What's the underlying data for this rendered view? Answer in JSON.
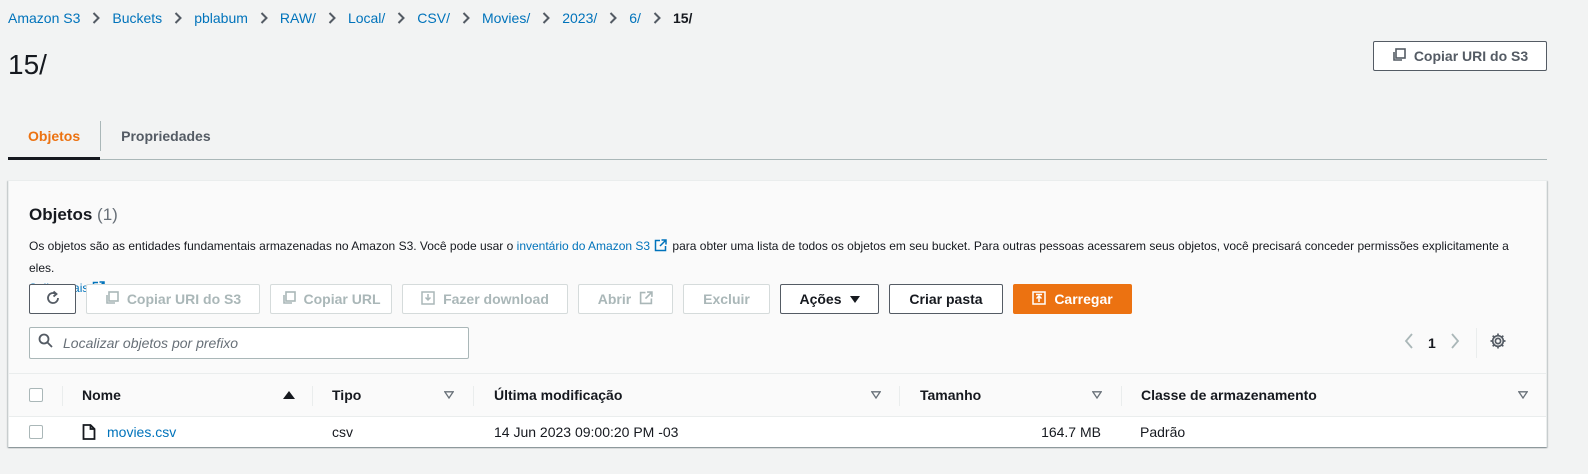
{
  "breadcrumbs": [
    "Amazon S3",
    "Buckets",
    "pblabum",
    "RAW/",
    "Local/",
    "CSV/",
    "Movies/",
    "2023/",
    "6/",
    "15/"
  ],
  "page_title": "15/",
  "header": {
    "copy_uri_label": "Copiar URI do S3"
  },
  "tabs": {
    "objects": "Objetos",
    "properties": "Propriedades"
  },
  "panel": {
    "title": "Objetos",
    "count": "(1)",
    "desc_before": "Os objetos são as entidades fundamentais armazenadas no Amazon S3. Você pode usar o ",
    "desc_link": "inventário do Amazon S3",
    "desc_after": " para obter uma lista de todos os objetos em seu bucket. Para outras pessoas acessarem seus objetos, você precisará conceder permissões explicitamente a eles.",
    "learn_more": "Saiba mais"
  },
  "toolbar": {
    "copy_uri": "Copiar URI do S3",
    "copy_url": "Copiar URL",
    "download": "Fazer download",
    "open": "Abrir",
    "delete": "Excluir",
    "actions": "Ações",
    "create_folder": "Criar pasta",
    "upload": "Carregar"
  },
  "search": {
    "placeholder": "Localizar objetos por prefixo"
  },
  "pagination": {
    "page": "1"
  },
  "table": {
    "headers": {
      "name": "Nome",
      "type": "Tipo",
      "modified": "Última modificação",
      "size": "Tamanho",
      "storage_class": "Classe de armazenamento"
    },
    "rows": [
      {
        "name": "movies.csv",
        "type": "csv",
        "modified": "14 Jun 2023 09:00:20 PM -03",
        "size": "164.7 MB",
        "storage_class": "Padrão"
      }
    ]
  },
  "colors": {
    "accent": "#ec7211",
    "link": "#0073bb",
    "text": "#16191f"
  }
}
